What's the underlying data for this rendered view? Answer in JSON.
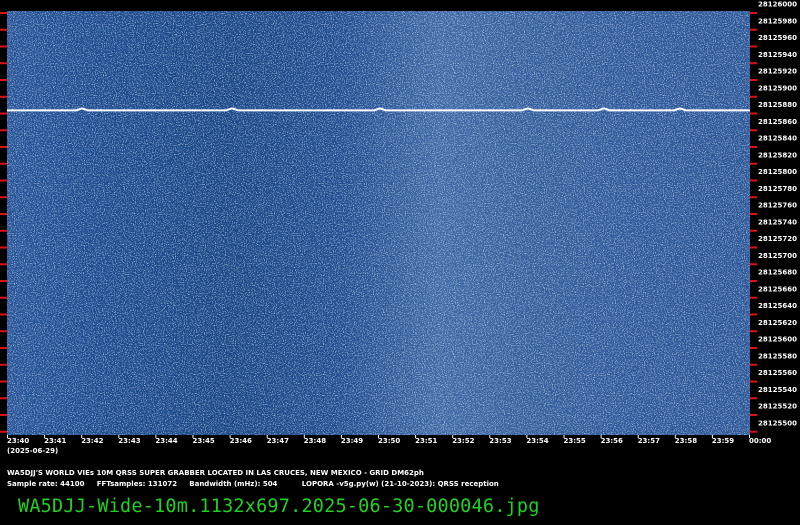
{
  "spectrogram": {
    "frequency_labels": [
      "28126000",
      "28125980",
      "28125960",
      "28125940",
      "28125920",
      "28125900",
      "28125880",
      "28125860",
      "28125840",
      "28125820",
      "28125800",
      "28125780",
      "28125760",
      "28125740",
      "28125720",
      "28125700",
      "28125680",
      "28125660",
      "28125640",
      "28125620",
      "28125600",
      "28125580",
      "28125560",
      "28125540",
      "28125520",
      "28125500"
    ],
    "time_labels": [
      "23:40",
      "23:41",
      "23:42",
      "23:43",
      "23:44",
      "23:45",
      "23:46",
      "23:47",
      "23:48",
      "23:49",
      "23:50",
      "23:51",
      "23:52",
      "23:53",
      "23:54",
      "23:55",
      "23:56",
      "23:57",
      "23:58",
      "23:59",
      "00:00"
    ],
    "date_label": "(2025-06-29)",
    "signal_frequency_hz": 28125873,
    "colors": {
      "background": "#1f4f92",
      "signal": "#ffffff",
      "tick": "#e01010"
    }
  },
  "footer": {
    "station": "WA5DJJ'S WORLD VIEs 10M QRSS SUPER GRABBER LOCATED IN LAS CRUCES, NEW MEXICO - GRID DM62ph",
    "params": "Sample rate: 44100     FFTsamples: 131072     Bandwidth (mHz): 504          LOPORA -v5g.py(w) (21-10-2023): QRSS reception",
    "filename": "WA5DJJ-Wide-10m.1132x697.2025-06-30-000046.jpg"
  }
}
